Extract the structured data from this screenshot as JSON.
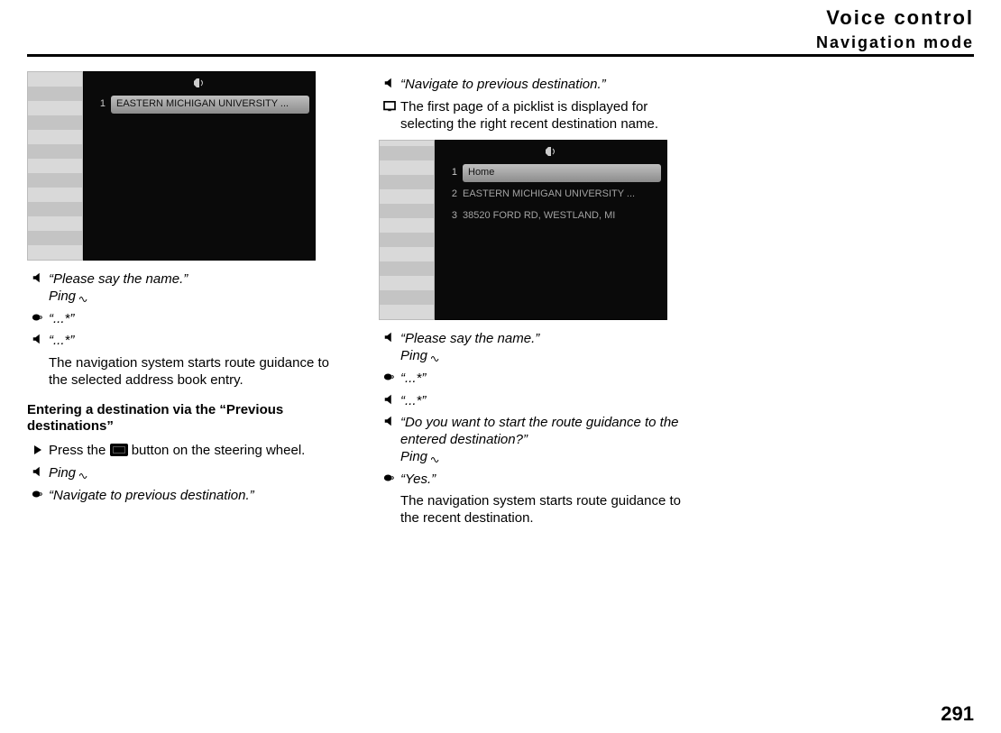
{
  "header": {
    "title": "Voice control",
    "subtitle": "Navigation mode"
  },
  "page_number": "291",
  "left_screenshot": {
    "row1_num": "1",
    "row1_label": "EASTERN MICHIGAN UNIVERSITY ..."
  },
  "right_screenshot": {
    "row1_num": "1",
    "row1_label": "Home",
    "row2_num": "2",
    "row2_label": "EASTERN MICHIGAN UNIVERSITY ...",
    "row3_num": "3",
    "row3_label": "38520 FORD RD, WESTLAND, MI"
  },
  "left_steps": {
    "s1a": "“Please say the name.”",
    "s1b": "Ping",
    "s2": "“...*”",
    "s3": "“...*”",
    "s4": "The navigation system starts route guidance to the selected address book entry."
  },
  "subheading": "Entering a destination via the “Previous destinations”",
  "left_steps2": {
    "s5a": "Press the ",
    "s5b": " button on the steering wheel.",
    "s6": "Ping",
    "s7": "“Navigate to previous destination.”"
  },
  "right_steps": {
    "r1": "“Navigate to previous destination.”",
    "r2": "The first page of a picklist is displayed for selecting the right recent destination name."
  },
  "right_steps2": {
    "r3a": "“Please say the name.”",
    "r3b": "Ping",
    "r4": "“...*”",
    "r5": "“...*”",
    "r6a": "“Do you want to start the route guidance to the entered destination?”",
    "r6b": "Ping",
    "r7": "“Yes.”",
    "r8": "The navigation system starts route guidance to the recent destination."
  }
}
